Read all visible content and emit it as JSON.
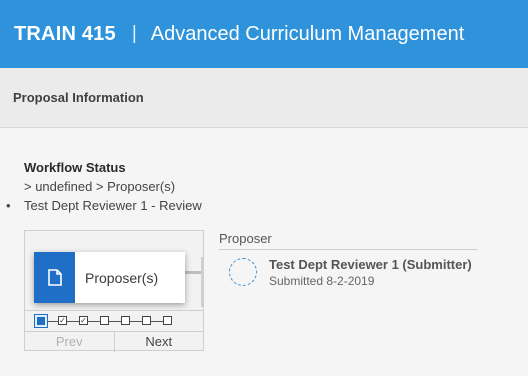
{
  "header": {
    "course_code": "TRAIN 415",
    "separator": "|",
    "app_title": "Advanced Curriculum Management",
    "accent_color": "#2e93db"
  },
  "section": {
    "title": "Proposal Information"
  },
  "workflow": {
    "heading": "Workflow Status",
    "path": "> undefined > Proposer(s)",
    "bullet_marker": "•",
    "current_step": "Test Dept Reviewer 1 - Review"
  },
  "viewer": {
    "card_label": "Proposer(s)",
    "card_icon": "document-icon",
    "step_count_boxes": 6,
    "checked_boxes": 2,
    "prev_label": "Prev",
    "next_label": "Next"
  },
  "detail": {
    "title": "Proposer",
    "reviewer_name": "Test Dept Reviewer 1 (Submitter)",
    "reviewer_status": "Submitted 8-2-2019"
  }
}
